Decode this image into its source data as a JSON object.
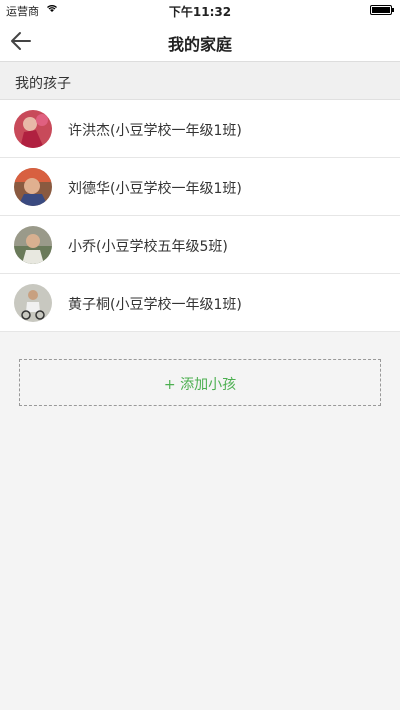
{
  "status": {
    "carrier": "运营商",
    "time": "下午11:32"
  },
  "nav": {
    "title": "我的家庭"
  },
  "section": {
    "title": "我的孩子"
  },
  "children": [
    {
      "name": "许洪杰(小豆学校一年级1班)",
      "avatar": "child-avatar-1"
    },
    {
      "name": "刘德华(小豆学校一年级1班)",
      "avatar": "child-avatar-2"
    },
    {
      "name": "小乔(小豆学校五年级5班)",
      "avatar": "child-avatar-3"
    },
    {
      "name": "黄子桐(小豆学校一年级1班)",
      "avatar": "child-avatar-4"
    }
  ],
  "add": {
    "label": "+ 添加小孩"
  },
  "colors": {
    "accent": "#4caf50",
    "background": "#f4f4f4"
  }
}
